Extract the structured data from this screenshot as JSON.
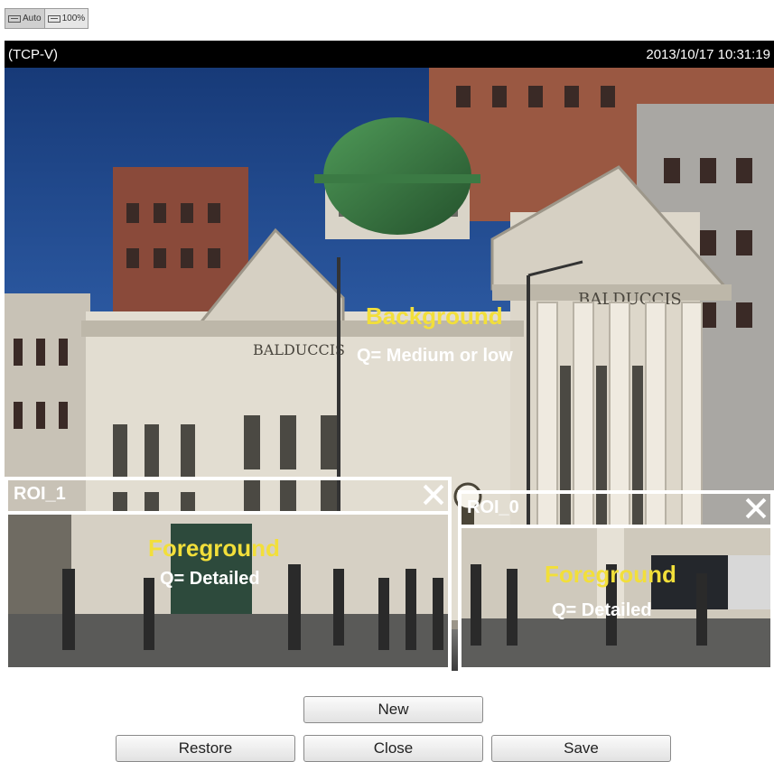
{
  "toolbar": {
    "auto_label": "Auto",
    "full_label": "100%"
  },
  "viewer": {
    "protocol": "(TCP-V)",
    "timestamp": "2013/10/17 10:31:19",
    "background_title": "Background",
    "background_quality": "Q= Medium or low",
    "building_sign": "BALDUCCIS"
  },
  "rois": [
    {
      "label": "ROI_1",
      "fg_title": "Foreground",
      "fg_quality": "Q= Detailed"
    },
    {
      "label": "ROI_0",
      "fg_title": "Foreground",
      "fg_quality": "Q= Detailed"
    }
  ],
  "buttons": {
    "new": "New",
    "restore": "Restore",
    "close": "Close",
    "save": "Save"
  },
  "colors": {
    "highlight_yellow": "#f2df3a",
    "status_bar": "#000000",
    "roi_border": "#ffffff"
  }
}
